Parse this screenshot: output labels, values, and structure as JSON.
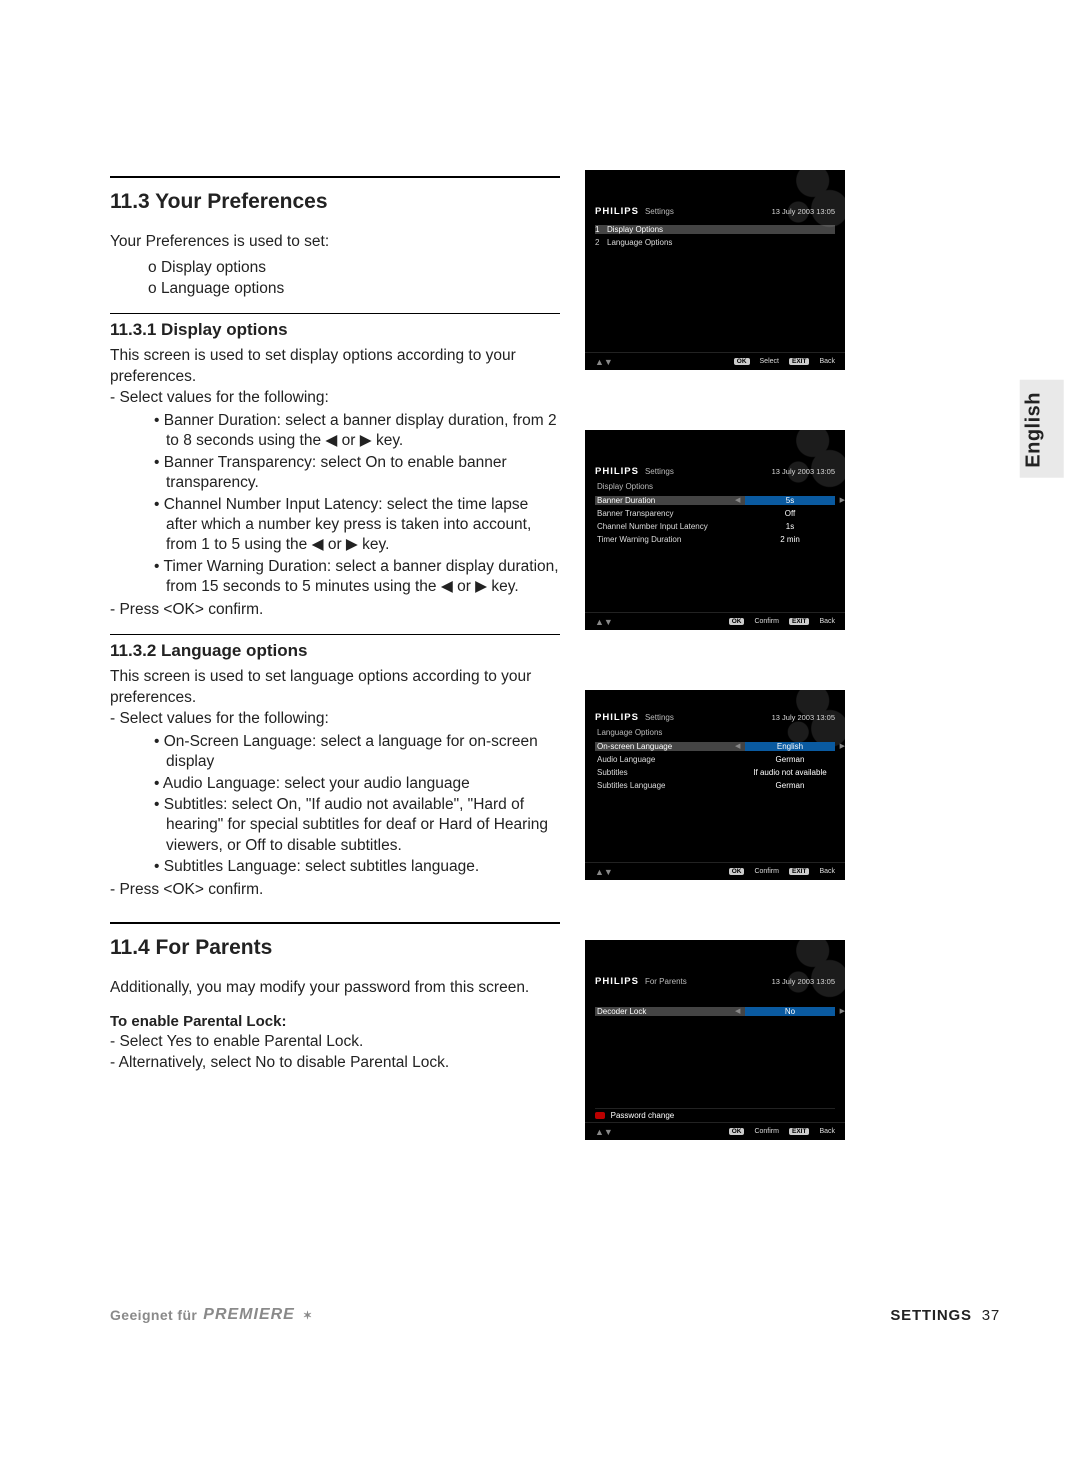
{
  "sideTab": "English",
  "s113": {
    "title": "11.3   Your Preferences",
    "intro": "Your Preferences is used to set:",
    "bul1": "Display options",
    "bul2": "Language options"
  },
  "s1131": {
    "title": "11.3.1  Display options",
    "intro": "This screen is used to set display options according to your preferences.",
    "d1": "Select values for the following:",
    "b1": "Banner Duration: select a banner display duration, from 2 to 8 seconds using the ◀ or ▶  key.",
    "b2": "Banner Transparency: select On to enable banner transparency.",
    "b3": "Channel Number Input Latency: select the time lapse after which a number key press is taken into account, from 1 to 5 using the ◀ or ▶  key.",
    "b4": "Timer Warning Duration: select a banner display duration, from 15 seconds to 5 minutes using the ◀ or ▶  key.",
    "d2": "Press <OK> confirm."
  },
  "s1132": {
    "title": "11.3.2  Language options",
    "intro": "This screen is used to set language options according to your preferences.",
    "d1": "Select values for the following:",
    "b1": "On-Screen Language: select a language for on-screen display",
    "b2": "Audio Language: select your audio language",
    "b3": "Subtitles: select On, \"If audio not available\", \"Hard of hearing\" for special subtitles for deaf or Hard of Hearing viewers, or Off to disable subtitles.",
    "b4": "Subtitles Language: select subtitles language.",
    "d2": "Press <OK> confirm."
  },
  "s114": {
    "title": "11.4   For Parents",
    "intro": "Additionally, you may modify your password from this screen.",
    "sub": "To enable Parental Lock:",
    "d1": "Select Yes to enable Parental Lock.",
    "d2": "Alternatively, select No to disable Parental Lock."
  },
  "shots": {
    "brand": "PHILIPS",
    "dt": "13 July 2003   13:05",
    "ok": "OK",
    "exit": "EXIT",
    "select_lbl": "Select",
    "back_lbl": "Back",
    "confirm_lbl": "Confirm",
    "nav": "▲▼",
    "s1": {
      "bc": "Settings",
      "r1n": "1",
      "r1l": "Display Options",
      "r2n": "2",
      "r2l": "Language Options"
    },
    "s2": {
      "bc": "Settings",
      "sub": "Display Options",
      "r1l": "Banner Duration",
      "r1v": "5s",
      "r2l": "Banner Transparency",
      "r2v": "Off",
      "r3l": "Channel Number Input Latency",
      "r3v": "1s",
      "r4l": "Timer Warning Duration",
      "r4v": "2 min"
    },
    "s3": {
      "bc": "Settings",
      "sub": "Language Options",
      "r1l": "On-screen Language",
      "r1v": "English",
      "r2l": "Audio Language",
      "r2v": "German",
      "r3l": "Subtitles",
      "r3v": "If audio not available",
      "r4l": "Subtitles Language",
      "r4v": "German"
    },
    "s4": {
      "bc": "For Parents",
      "r1l": "Decoder Lock",
      "r1v": "No",
      "pw": "Password change"
    }
  },
  "footer": {
    "left": "Geeignet für",
    "brand": "PREMIERE",
    "star": "✶",
    "section": "SETTINGS",
    "page": "37"
  }
}
